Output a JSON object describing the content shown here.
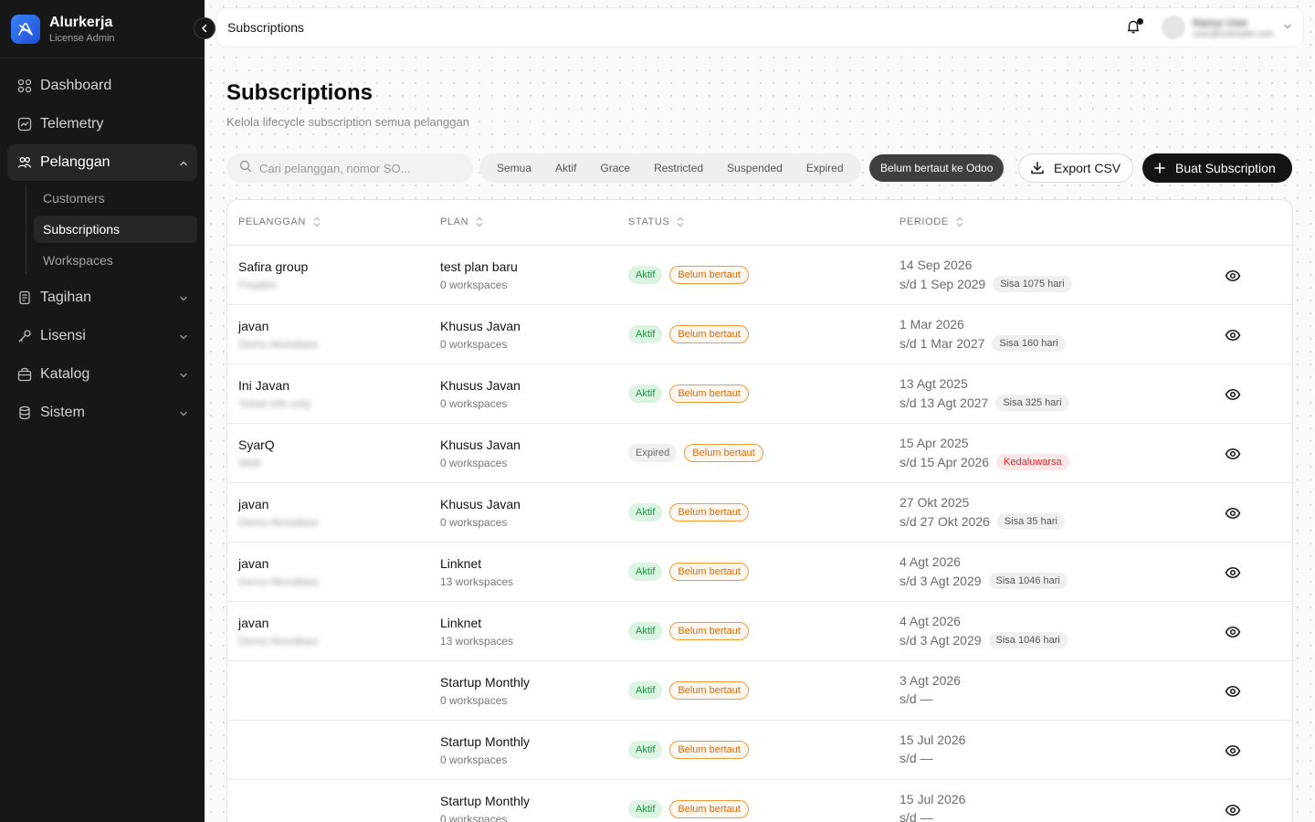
{
  "brand": {
    "name": "Alurkerja",
    "subtitle": "License Admin"
  },
  "sidebar": {
    "items": [
      {
        "label": "Dashboard",
        "icon": "dashboard-icon"
      },
      {
        "label": "Telemetry",
        "icon": "chart-icon"
      },
      {
        "label": "Pelanggan",
        "icon": "users-icon",
        "expanded": true
      },
      {
        "label": "Tagihan",
        "icon": "receipt-icon"
      },
      {
        "label": "Lisensi",
        "icon": "key-icon"
      },
      {
        "label": "Katalog",
        "icon": "package-icon"
      },
      {
        "label": "Sistem",
        "icon": "database-icon"
      }
    ],
    "pelanggan_sub": [
      "Customers",
      "Subscriptions",
      "Workspaces"
    ]
  },
  "topbar": {
    "title": "Subscriptions",
    "user_name": "Nama User",
    "user_email": "user@example.com"
  },
  "page": {
    "title": "Subscriptions",
    "subtitle": "Kelola lifecycle subscription semua pelanggan"
  },
  "toolbar": {
    "search_placeholder": "Cari pelanggan, nomor SO...",
    "filters": [
      "Semua",
      "Aktif",
      "Grace",
      "Restricted",
      "Suspended",
      "Expired"
    ],
    "odoo_filter": "Belum bertaut ke Odoo",
    "export_label": "Export CSV",
    "create_label": "Buat Subscription"
  },
  "table": {
    "headers": {
      "customer": "PELANGGAN",
      "plan": "PLAN",
      "status": "STATUS",
      "period": "PERIODE"
    },
    "rows": [
      {
        "customer": "Safira group",
        "customer_sub": "Finjatim",
        "plan": "test plan baru",
        "workspaces": "0 workspaces",
        "status": "Aktif",
        "link": "Belum bertaut",
        "start": "14 Sep 2026",
        "end": "s/d 1 Sep 2029",
        "remaining": "Sisa 1075 hari",
        "remaining_style": "normal"
      },
      {
        "customer": "javan",
        "customer_sub": "Demo Akreditasi",
        "plan": "Khusus Javan",
        "workspaces": "0 workspaces",
        "status": "Aktif",
        "link": "Belum bertaut",
        "start": "1 Mar 2026",
        "end": "s/d 1 Mar 2027",
        "remaining": "Sisa 160 hari",
        "remaining_style": "normal"
      },
      {
        "customer": "Ini Javan",
        "customer_sub": "Yolsel info only",
        "plan": "Khusus Javan",
        "workspaces": "0 workspaces",
        "status": "Aktif",
        "link": "Belum bertaut",
        "start": "13 Agt 2025",
        "end": "s/d 13 Agt 2027",
        "remaining": "Sisa 325 hari",
        "remaining_style": "normal"
      },
      {
        "customer": "SyarQ",
        "customer_sub": "Web",
        "plan": "Khusus Javan",
        "workspaces": "0 workspaces",
        "status": "Expired",
        "link": "Belum bertaut",
        "start": "15 Apr 2025",
        "end": "s/d 15 Apr 2026",
        "remaining": "Kedaluwarsa",
        "remaining_style": "warn"
      },
      {
        "customer": "javan",
        "customer_sub": "Demo Akreditasi",
        "plan": "Khusus Javan",
        "workspaces": "0 workspaces",
        "status": "Aktif",
        "link": "Belum bertaut",
        "start": "27 Okt 2025",
        "end": "s/d 27 Okt 2026",
        "remaining": "Sisa 35 hari",
        "remaining_style": "normal"
      },
      {
        "customer": "javan",
        "customer_sub": "Demo Akreditasi",
        "plan": "Linknet",
        "workspaces": "13 workspaces",
        "status": "Aktif",
        "link": "Belum bertaut",
        "start": "4 Agt 2026",
        "end": "s/d 3 Agt 2029",
        "remaining": "Sisa 1046 hari",
        "remaining_style": "normal"
      },
      {
        "customer": "javan",
        "customer_sub": "Demo Akreditasi",
        "plan": "Linknet",
        "workspaces": "13 workspaces",
        "status": "Aktif",
        "link": "Belum bertaut",
        "start": "4 Agt 2026",
        "end": "s/d 3 Agt 2029",
        "remaining": "Sisa 1046 hari",
        "remaining_style": "normal"
      },
      {
        "customer": "",
        "customer_sub": "",
        "plan": "Startup Monthly",
        "workspaces": "0 workspaces",
        "status": "Aktif",
        "link": "Belum bertaut",
        "start": "3 Agt 2026",
        "end": "s/d —",
        "remaining": "",
        "remaining_style": "normal"
      },
      {
        "customer": "",
        "customer_sub": "",
        "plan": "Startup Monthly",
        "workspaces": "0 workspaces",
        "status": "Aktif",
        "link": "Belum bertaut",
        "start": "15 Jul 2026",
        "end": "s/d —",
        "remaining": "",
        "remaining_style": "normal"
      },
      {
        "customer": "",
        "customer_sub": "",
        "plan": "Startup Monthly",
        "workspaces": "0 workspaces",
        "status": "Aktif",
        "link": "Belum bertaut",
        "start": "15 Jul 2026",
        "end": "s/d —",
        "remaining": "",
        "remaining_style": "normal"
      }
    ]
  },
  "colors": {
    "sidebar_bg": "#171717",
    "active_badge": "#1f8f46",
    "unlinked_badge": "#d96a0a",
    "expired_warn": "#dc2626",
    "primary_button": "#141414"
  }
}
